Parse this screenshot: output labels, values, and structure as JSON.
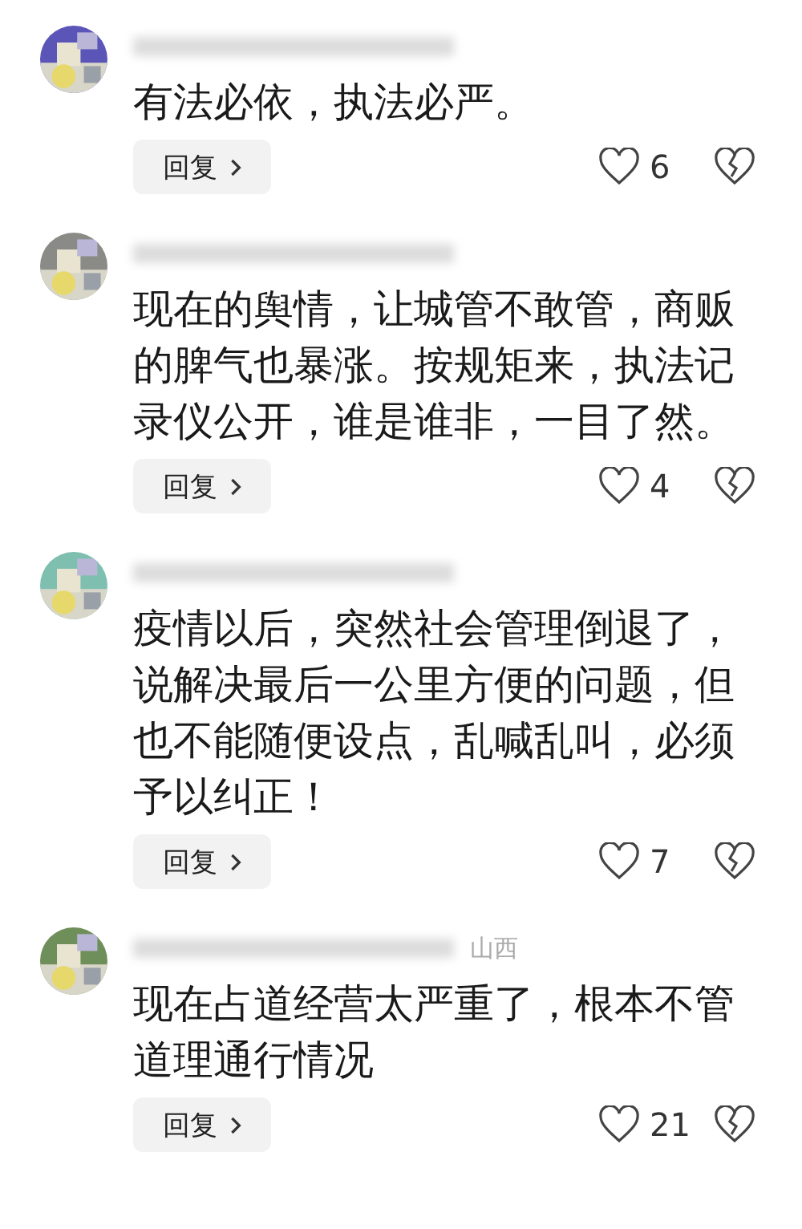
{
  "comments": [
    {
      "text": "有法必依，执法必严。",
      "reply": "回复",
      "likes": "6"
    },
    {
      "text": "现在的舆情，让城管不敢管，商贩的脾气也暴涨。按规矩来，执法记录仪公开，谁是谁非，一目了然。",
      "reply": "回复",
      "likes": "4"
    },
    {
      "text": "疫情以后，突然社会管理倒退了，说解决最后一公里方便的问题，但也不能随便设点，乱喊乱叫，必须予以纠正！",
      "reply": "回复",
      "likes": "7"
    },
    {
      "location": "山西",
      "text": "现在占道经营太严重了，根本不管道理通行情况",
      "reply": "回复",
      "likes": "21"
    }
  ]
}
